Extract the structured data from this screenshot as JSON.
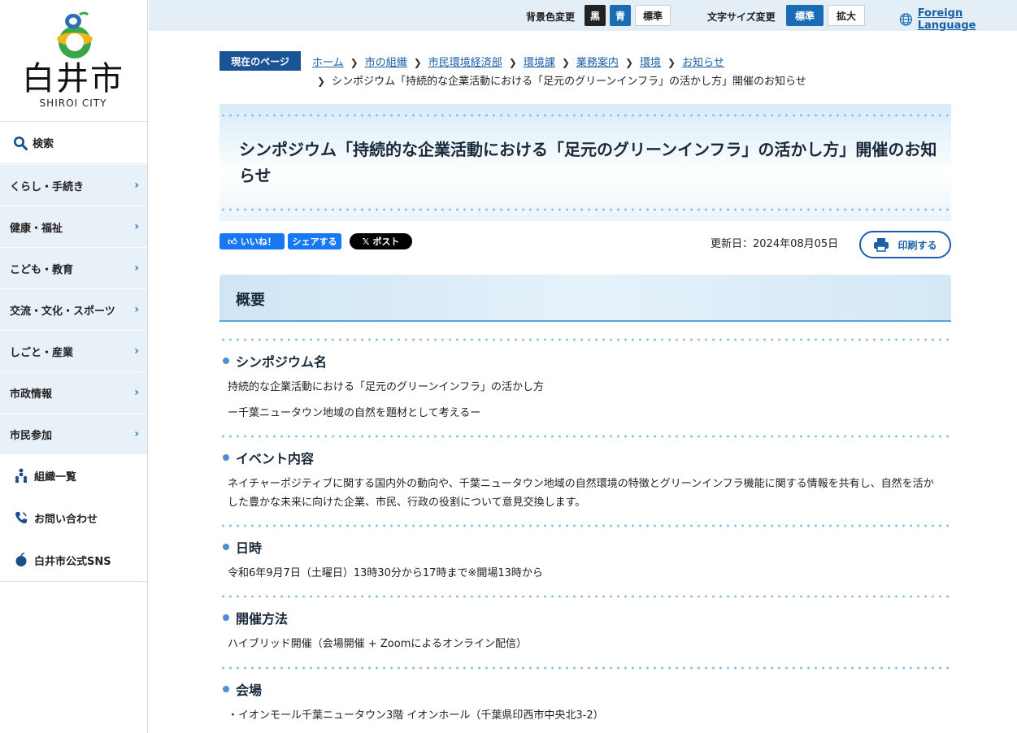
{
  "logo": {
    "name": "白井市",
    "sub": "SHIROI CITY"
  },
  "sidebar": {
    "search_label": "検索",
    "nav": [
      {
        "label": "くらし・手続き"
      },
      {
        "label": "健康・福祉"
      },
      {
        "label": "こども・教育"
      },
      {
        "label": "交流・文化・スポーツ"
      },
      {
        "label": "しごと・産業"
      },
      {
        "label": "市政情報"
      },
      {
        "label": "市民参加"
      }
    ],
    "utils": [
      {
        "label": "組織一覧",
        "icon": "org-chart-icon"
      },
      {
        "label": "お問い合わせ",
        "icon": "phone-icon"
      },
      {
        "label": "白井市公式SNS",
        "icon": "pear-icon"
      }
    ]
  },
  "topbar": {
    "bg_label": "背景色変更",
    "bg_black": "黒",
    "bg_blue": "青",
    "bg_standard": "標準",
    "fs_label": "文字サイズ変更",
    "fs_standard": "標準",
    "fs_large": "拡大",
    "foreign": "Foreign Language"
  },
  "breadcrumb": {
    "tag": "現在のページ",
    "items": [
      "ホーム",
      "市の組織",
      "市民環境経済部",
      "環境課",
      "業務案内",
      "環境",
      "お知らせ"
    ],
    "current": "シンポジウム「持続的な企業活動における「足元のグリーンインフラ」の活かし方」開催のお知らせ"
  },
  "page": {
    "title": "シンポジウム「持続的な企業活動における「足元のグリーンインフラ」の活かし方」開催のお知らせ",
    "updated": "更新日：2024年08月05日",
    "print": "印刷する"
  },
  "share": {
    "like": "いいね！",
    "share": "シェアする",
    "post": "ポスト"
  },
  "summary": {
    "title": "概要"
  },
  "sections": [
    {
      "heading": "シンポジウム名",
      "lines": [
        "持続的な企業活動における「足元のグリーンインフラ」の活かし方",
        "ー千葉ニュータウン地域の自然を題材として考えるー"
      ]
    },
    {
      "heading": "イベント内容",
      "lines": [
        "ネイチャーポジティブに関する国内外の動向や、千葉ニュータウン地域の自然環境の特徴とグリーンインフラ機能に関する情報を共有し、自然を活かした豊かな未来に向けた企業、市民、行政の役割について意見交換します。"
      ]
    },
    {
      "heading": "日時",
      "lines": [
        "令和6年9月7日（土曜日）13時30分から17時まで※開場13時から"
      ]
    },
    {
      "heading": "開催方法",
      "lines": [
        "ハイブリッド開催（会場開催 + Zoomによるオンライン配信）"
      ]
    },
    {
      "heading": "会場",
      "lines": [
        "・イオンモール千葉ニュータウン3階 イオンホール（千葉県印西市中央北3-2）"
      ]
    }
  ],
  "colors": {
    "accent_blue": "#1a6cb5",
    "nav_bg": "#e9f1f8",
    "crumb_tag": "#1a5496",
    "facebook": "#1877f2"
  }
}
